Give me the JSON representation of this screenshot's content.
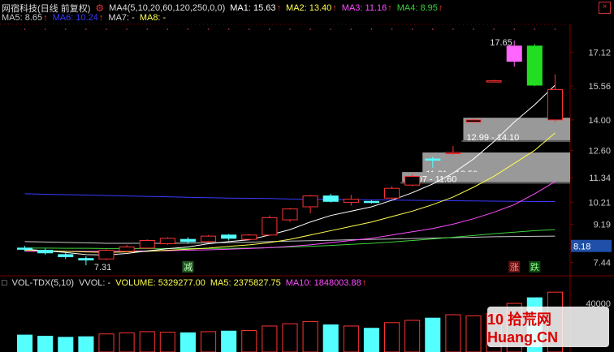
{
  "legend": {
    "stock_name": "网宿科技(日线 前复权)",
    "ma4_params": "MA4(5,10,20,60,120,250,0,0)",
    "ma1": "MA1: 15.63",
    "ma2": "MA2: 13.40",
    "ma3": "MA3: 11.16",
    "ma4": "MA4: 8.95",
    "ma5": "MA5: 8.65",
    "ma6": "MA6: 10.24",
    "ma7": "MA7: -",
    "ma8": "MA8: -",
    "arrow": "↑"
  },
  "colors": {
    "up": "#ff3333",
    "down": "#54ffff",
    "ma1": "#ffffff",
    "ma2": "#ffff4d",
    "ma3": "#ff4dff",
    "ma4": "#3cd23c",
    "ma5": "#c8c8c8",
    "ma6": "#3a3aff",
    "grid": "#7a0000",
    "axis_text": "#c8c8c8",
    "price_box": "#1f4fa8"
  },
  "annotations": {
    "high_label": "17.65",
    "low_label": "7.31",
    "zone1": "12.99 - 14.10",
    "zone2": "11.31 - 12.50",
    "zone3": "11.07 - 11.60",
    "marker_reduce": "减",
    "marker_rise": "涨",
    "marker_fall": "跌",
    "current_price": "8.18"
  },
  "vol_legend": {
    "name": "VOL-TDX(5,10)",
    "vvol": "VVOL: -",
    "volume": "VOLUME: 5329277.00",
    "ma5": "MA5: 2375827.75",
    "ma10": "MA10: 1848003.88"
  },
  "watermark": "10 拾荒网 Huang.CN",
  "chart_data": {
    "type": "candlestick",
    "y_ticks": [
      "17.12",
      "15.56",
      "14.00",
      "12.60",
      "11.34",
      "10.21",
      "9.19",
      "7.44"
    ],
    "ylim": [
      6.9,
      18.4
    ],
    "vol_ticks": [
      "40000"
    ],
    "candles": [
      {
        "o": 8.1,
        "h": 8.2,
        "l": 7.95,
        "c": 8.05
      },
      {
        "o": 8.0,
        "h": 8.08,
        "l": 7.8,
        "c": 7.88
      },
      {
        "o": 7.8,
        "h": 7.9,
        "l": 7.6,
        "c": 7.7
      },
      {
        "o": 7.62,
        "h": 7.72,
        "l": 7.31,
        "c": 7.55
      },
      {
        "o": 7.6,
        "h": 8.05,
        "l": 7.55,
        "c": 8.0
      },
      {
        "o": 7.95,
        "h": 8.25,
        "l": 7.9,
        "c": 8.15
      },
      {
        "o": 8.1,
        "h": 8.5,
        "l": 8.05,
        "c": 8.45
      },
      {
        "o": 8.3,
        "h": 8.6,
        "l": 8.25,
        "c": 8.55
      },
      {
        "o": 8.5,
        "h": 8.6,
        "l": 8.3,
        "c": 8.4
      },
      {
        "o": 8.4,
        "h": 8.7,
        "l": 8.35,
        "c": 8.65
      },
      {
        "o": 8.7,
        "h": 8.75,
        "l": 8.45,
        "c": 8.55
      },
      {
        "o": 8.5,
        "h": 8.75,
        "l": 8.45,
        "c": 8.7
      },
      {
        "o": 8.7,
        "h": 9.6,
        "l": 8.65,
        "c": 9.5
      },
      {
        "o": 9.4,
        "h": 9.95,
        "l": 9.3,
        "c": 9.9
      },
      {
        "o": 10.0,
        "h": 10.55,
        "l": 9.7,
        "c": 10.5
      },
      {
        "o": 10.5,
        "h": 10.6,
        "l": 10.2,
        "c": 10.25
      },
      {
        "o": 10.2,
        "h": 10.55,
        "l": 10.05,
        "c": 10.35
      },
      {
        "o": 10.25,
        "h": 10.3,
        "l": 10.15,
        "c": 10.2
      },
      {
        "o": 10.4,
        "h": 10.95,
        "l": 10.35,
        "c": 10.85
      },
      {
        "o": 11.0,
        "h": 11.5,
        "l": 10.95,
        "c": 11.4
      },
      {
        "o": 12.2,
        "h": 12.3,
        "l": 11.8,
        "c": 12.15
      },
      {
        "o": 12.5,
        "h": 12.8,
        "l": 12.4,
        "c": 12.5
      },
      {
        "o": 13.9,
        "h": 14.05,
        "l": 13.9,
        "c": 14.0
      },
      {
        "o": 15.8,
        "h": 15.85,
        "l": 15.75,
        "c": 15.8
      },
      {
        "o": 16.7,
        "h": 17.65,
        "l": 16.45,
        "c": 17.4
      },
      {
        "o": 17.4,
        "h": 17.5,
        "l": 15.55,
        "c": 15.6
      },
      {
        "o": 14.0,
        "h": 16.1,
        "l": 13.9,
        "c": 15.4
      }
    ],
    "ma": {
      "ma1": [
        8.05,
        7.98,
        7.9,
        7.8,
        7.78,
        7.85,
        7.97,
        8.07,
        8.15,
        8.3,
        8.4,
        8.48,
        8.7,
        8.95,
        9.3,
        9.6,
        9.8,
        10.0,
        10.3,
        10.65,
        11.05,
        11.55,
        12.2,
        13.0,
        13.9,
        14.7,
        15.6
      ],
      "ma2": [
        8.0,
        7.98,
        7.95,
        7.92,
        7.9,
        7.92,
        7.95,
        8.0,
        8.05,
        8.1,
        8.18,
        8.25,
        8.35,
        8.5,
        8.7,
        8.9,
        9.1,
        9.3,
        9.55,
        9.8,
        10.1,
        10.45,
        10.9,
        11.4,
        12.0,
        12.6,
        13.4
      ],
      "ma3": [
        7.95,
        7.95,
        7.95,
        7.95,
        7.95,
        7.96,
        7.97,
        7.98,
        8.0,
        8.02,
        8.05,
        8.08,
        8.12,
        8.18,
        8.25,
        8.35,
        8.45,
        8.55,
        8.7,
        8.85,
        9.0,
        9.2,
        9.45,
        9.75,
        10.1,
        10.6,
        11.16
      ],
      "ma4": [
        8.1,
        8.1,
        8.09,
        8.09,
        8.08,
        8.08,
        8.08,
        8.08,
        8.08,
        8.08,
        8.09,
        8.1,
        8.12,
        8.15,
        8.18,
        8.22,
        8.27,
        8.32,
        8.38,
        8.45,
        8.52,
        8.6,
        8.68,
        8.76,
        8.83,
        8.9,
        8.95
      ],
      "ma5": [
        8.4,
        8.38,
        8.36,
        8.34,
        8.32,
        8.32,
        8.32,
        8.32,
        8.33,
        8.34,
        8.35,
        8.37,
        8.4,
        8.42,
        8.44,
        8.46,
        8.48,
        8.5,
        8.52,
        8.54,
        8.56,
        8.58,
        8.6,
        8.62,
        8.63,
        8.64,
        8.65
      ],
      "ma6": [
        10.6,
        10.58,
        10.56,
        10.54,
        10.52,
        10.5,
        10.48,
        10.46,
        10.44,
        10.42,
        10.4,
        10.39,
        10.38,
        10.36,
        10.35,
        10.34,
        10.33,
        10.32,
        10.31,
        10.3,
        10.29,
        10.28,
        10.27,
        10.26,
        10.25,
        10.24,
        10.24
      ]
    },
    "zones": [
      {
        "label": "12.99 - 14.10",
        "low": 12.99,
        "high": 14.1,
        "start": 22
      },
      {
        "label": "11.31 - 12.50",
        "low": 11.31,
        "high": 12.5,
        "start": 20
      },
      {
        "label": "11.07 - 11.60",
        "low": 11.07,
        "high": 11.6,
        "start": 19
      }
    ],
    "volume": [
      1500,
      1400,
      1300,
      1350,
      1600,
      1700,
      1800,
      1750,
      1700,
      1800,
      1850,
      1900,
      2300,
      2500,
      2700,
      2400,
      2300,
      2100,
      2600,
      2800,
      3000,
      3300,
      3200,
      3400,
      4300,
      4800,
      5300
    ],
    "vol_max": 5600
  }
}
